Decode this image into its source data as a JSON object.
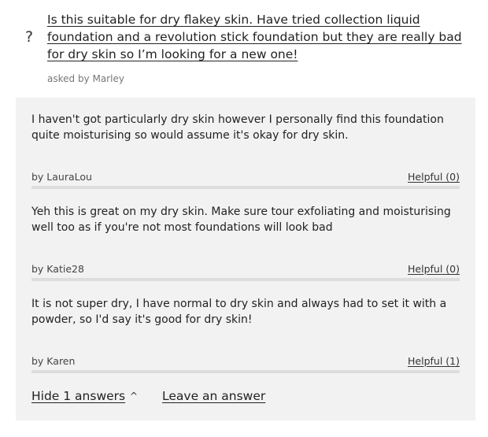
{
  "question": {
    "icon": "question-mark-icon",
    "text": "Is this suitable for dry flakey skin. Have tried collection liquid foundation and a revolution stick foundation but they are really bad for dry skin so I’m looking for a new one!",
    "asked_by": "asked by Marley"
  },
  "answers": [
    {
      "text": "I haven't got particularly dry skin however I personally find this foundation quite moisturising so would assume it's okay for dry skin.",
      "author": "by LauraLou",
      "helpful": "Helpful (0)"
    },
    {
      "text": "Yeh this is great on my dry skin. Make sure tour exfoliating and moisturising well too as if you're not most foundations will look bad",
      "author": "by Katie28",
      "helpful": "Helpful (0)"
    },
    {
      "text": "It is not super dry, I have normal to dry skin and always had to set it with a powder, so I'd say it's good for dry skin!",
      "author": "by Karen",
      "helpful": "Helpful (1)"
    }
  ],
  "footer": {
    "hide_label": "Hide 1 answers",
    "chevron": "^",
    "leave_label": "Leave an answer"
  },
  "colors": {
    "panel_background": "#f2f2f2",
    "divider": "#dddddd",
    "text": "#222222"
  }
}
